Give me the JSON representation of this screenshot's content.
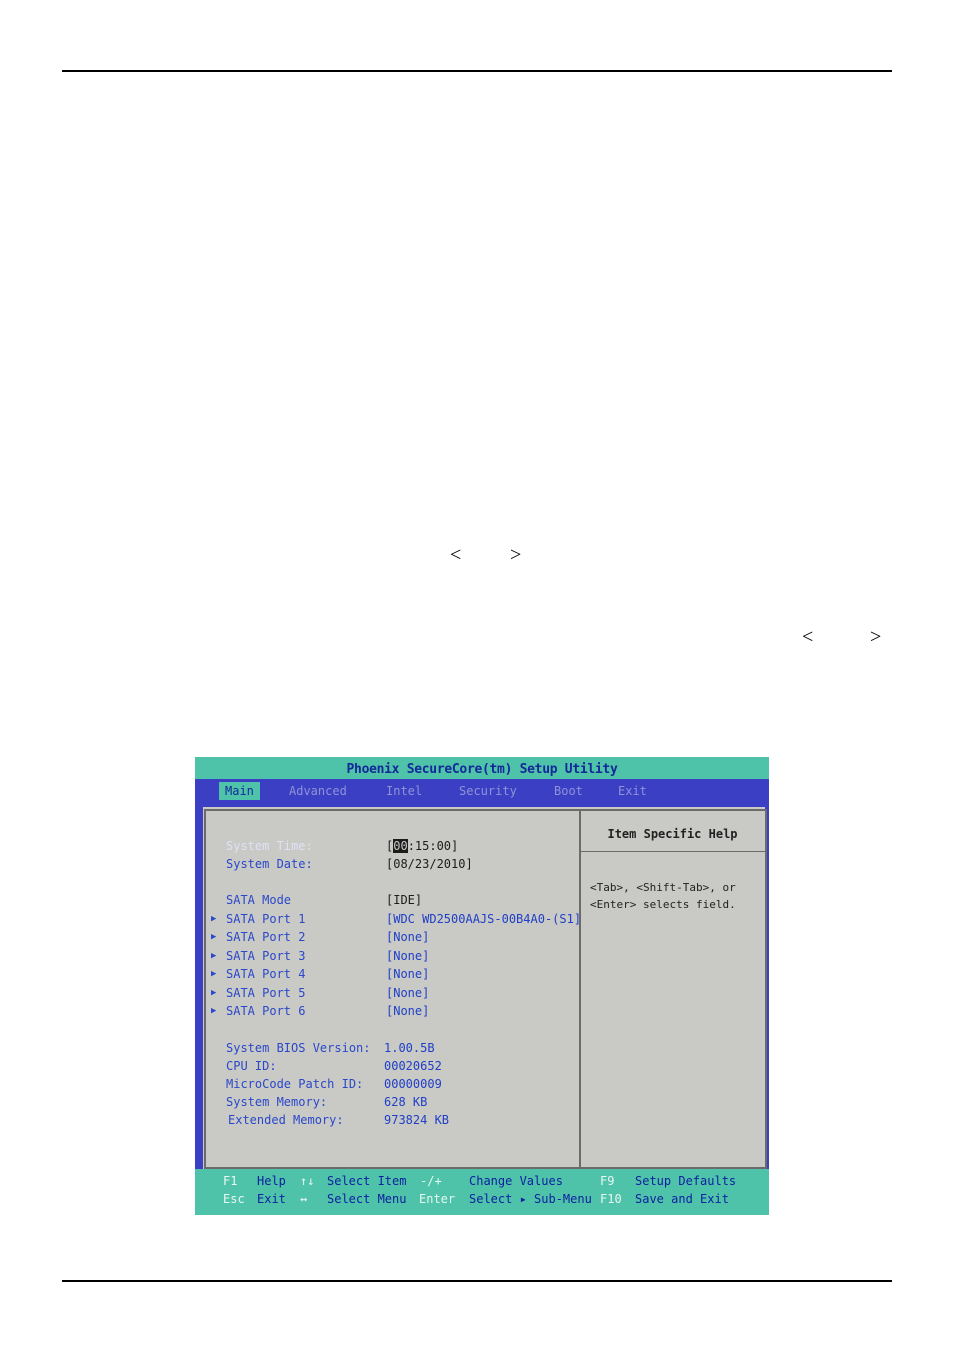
{
  "page": {
    "angle_left_1": "<",
    "angle_right_1": ">",
    "angle_left_2": "<",
    "angle_right_2": ">"
  },
  "bios": {
    "title": "Phoenix SecureCore(tm) Setup Utility",
    "tabs": [
      {
        "label": "Main",
        "active": true
      },
      {
        "label": "Advanced",
        "active": false
      },
      {
        "label": "Intel",
        "active": false
      },
      {
        "label": "Security",
        "active": false
      },
      {
        "label": "Boot",
        "active": false
      },
      {
        "label": "Exit",
        "active": false
      }
    ],
    "rows": {
      "system_time": {
        "label": "System Time:",
        "value_cursor": "00",
        "value_rest": ":15:00]",
        "value_open": "["
      },
      "system_date": {
        "label": "System Date:",
        "value": "[08/23/2010]"
      },
      "sata_mode": {
        "label": "SATA Mode",
        "value": "[IDE]"
      },
      "sata_ports": [
        {
          "label": "SATA Port 1",
          "value": "[WDC WD2500AAJS-00B4A0-(S1]"
        },
        {
          "label": "SATA Port 2",
          "value": "[None]"
        },
        {
          "label": "SATA Port 3",
          "value": "[None]"
        },
        {
          "label": "SATA Port 4",
          "value": "[None]"
        },
        {
          "label": "SATA Port 5",
          "value": "[None]"
        },
        {
          "label": "SATA Port 6",
          "value": "[None]"
        }
      ],
      "info": [
        {
          "label": "System BIOS Version:",
          "value": "1.00.5B"
        },
        {
          "label": "CPU ID:",
          "value": "00020652"
        },
        {
          "label": "MicroCode Patch ID:",
          "value": "00000009"
        },
        {
          "label": "System Memory:",
          "value": "628 KB"
        },
        {
          "label": "Extended Memory:",
          "value": "973824 KB"
        }
      ]
    },
    "help": {
      "title": "Item Specific Help",
      "text": "<Tab>, <Shift-Tab>, or\n<Enter> selects field."
    },
    "footer": {
      "f1": "F1",
      "help": "Help",
      "updown": "↑↓",
      "select_item": "Select Item",
      "minusplus": "-/+",
      "change_values": "Change Values",
      "f9": "F9",
      "setup_defaults": "Setup Defaults",
      "esc": "Esc",
      "exit": "Exit",
      "leftright": "↔",
      "select_menu": "Select Menu",
      "enter": "Enter",
      "select_submenu": "Select ▸ Sub-Menu",
      "f10": "F10",
      "save_exit": "Save and Exit"
    },
    "colors": {
      "title_bg": "#4fc3a9",
      "menu_bg": "#3a3fc4",
      "panel_bg": "#c9c9c6",
      "label_blue": "#2a48c8"
    }
  }
}
